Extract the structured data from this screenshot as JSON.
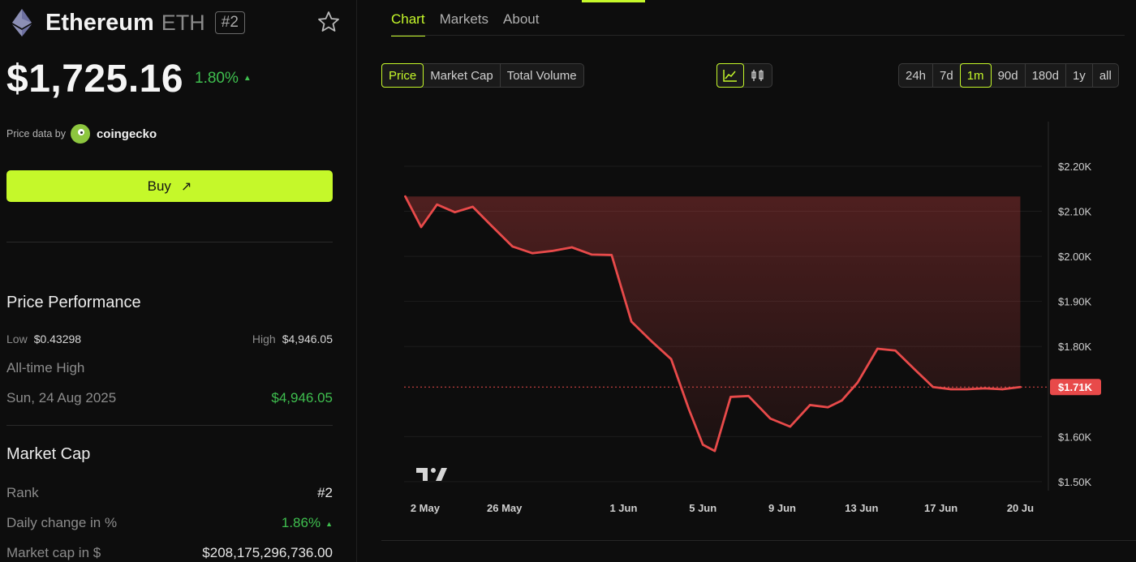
{
  "coin": {
    "name": "Ethereum",
    "symbol": "ETH",
    "rank_badge": "#2",
    "price": "$1,725.16",
    "change": "1.80%",
    "change_arrow": "▲",
    "price_data_by": "Price data by",
    "provider": "coingecko"
  },
  "buy": {
    "label": "Buy",
    "arrow": "↗"
  },
  "performance": {
    "title": "Price Performance",
    "low_label": "Low",
    "low_value": "$0.43298",
    "high_label": "High",
    "high_value": "$4,946.05",
    "ath_label": "All-time High",
    "ath_date": "Sun, 24 Aug 2025",
    "ath_value": "$4,946.05"
  },
  "market_cap": {
    "title": "Market Cap",
    "rank_label": "Rank",
    "rank_value": "#2",
    "daily_label": "Daily change in %",
    "daily_value": "1.86%",
    "daily_arrow": "▲",
    "cap_label": "Market cap in $",
    "cap_value": "$208,175,296,736.00"
  },
  "tabs": [
    {
      "label": "Chart",
      "active": true
    },
    {
      "label": "Markets",
      "active": false
    },
    {
      "label": "About",
      "active": false
    }
  ],
  "metric_options": [
    {
      "label": "Price",
      "active": true
    },
    {
      "label": "Market Cap",
      "active": false
    },
    {
      "label": "Total Volume",
      "active": false
    }
  ],
  "chart_type_options": [
    {
      "icon": "line-chart-icon",
      "active": true
    },
    {
      "icon": "candlestick-icon",
      "active": false
    }
  ],
  "range_options": [
    {
      "label": "24h",
      "active": false
    },
    {
      "label": "7d",
      "active": false
    },
    {
      "label": "1m",
      "active": true
    },
    {
      "label": "90d",
      "active": false
    },
    {
      "label": "180d",
      "active": false
    },
    {
      "label": "1y",
      "active": false
    },
    {
      "label": "all",
      "active": false
    }
  ],
  "colors": {
    "accent": "#c5f82a",
    "line": "#e84a4a",
    "positive": "#3fbf4f",
    "current_label_bg": "#e84a4a"
  },
  "chart_data": {
    "type": "area",
    "x_tick_labels": [
      "2 May",
      "26 May",
      "1 Jun",
      "5 Jun",
      "9 Jun",
      "13 Jun",
      "17 Jun",
      "20 Ju"
    ],
    "x_tick_days": [
      0,
      4,
      10,
      14,
      18,
      22,
      26,
      30
    ],
    "y_tick_labels": [
      "$2.20K",
      "$2.10K",
      "$2.00K",
      "$1.90K",
      "$1.80K",
      "$1.60K",
      "$1.50K"
    ],
    "y_tick_values": [
      2200,
      2100,
      2000,
      1900,
      1800,
      1600,
      1500
    ],
    "ylim": [
      1480,
      2290
    ],
    "current_price_label": "$1.71K",
    "current_price_value": 1710,
    "series": [
      {
        "x_days": [
          -1,
          -0.2,
          0.6,
          1.5,
          2.4,
          3.3,
          4.4,
          5.4,
          6.4,
          7.4,
          8.4,
          9.4,
          10.4,
          11.4,
          12.4,
          13.3,
          14.0,
          14.6,
          15.4,
          16.3,
          17.4,
          18.4,
          19.4,
          20.3,
          21.0,
          21.8,
          22.8,
          23.7,
          24.7,
          25.6,
          26.5,
          27.3,
          28.2,
          29.1,
          30.0
        ],
        "values": [
          2133,
          2065,
          2115,
          2098,
          2110,
          2070,
          2022,
          2007,
          2012,
          2020,
          2004,
          2003,
          1855,
          1812,
          1772,
          1660,
          1582,
          1568,
          1688,
          1690,
          1640,
          1622,
          1670,
          1665,
          1680,
          1720,
          1795,
          1791,
          1748,
          1710,
          1705,
          1705,
          1707,
          1705,
          1710
        ]
      }
    ]
  }
}
